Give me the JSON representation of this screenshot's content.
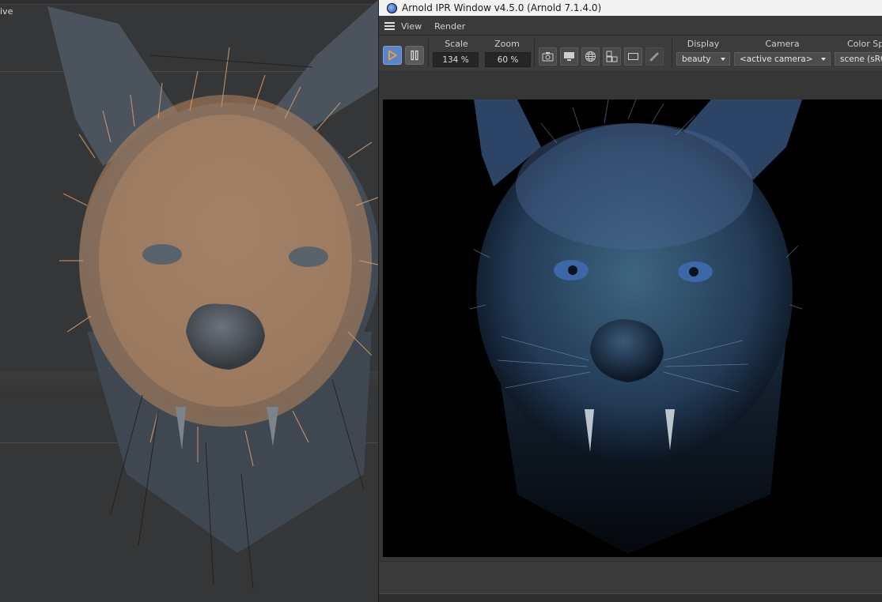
{
  "viewport": {
    "label": "ive"
  },
  "ipr": {
    "title": "Arnold IPR Window v4.5.0 (Arnold 7.1.4.0)",
    "menu": [
      "View",
      "Render"
    ],
    "scale": {
      "label": "Scale",
      "value": "134 %"
    },
    "zoom": {
      "label": "Zoom",
      "value": "60 %"
    },
    "display": {
      "label": "Display",
      "value": "beauty"
    },
    "camera": {
      "label": "Camera",
      "value": "<active camera>"
    },
    "color_space": {
      "label": "Color Spa",
      "value": "scene (sRGB"
    }
  },
  "colors": {
    "accent": "#5c85c9",
    "fur_viewport": "#c8946a",
    "render_tint": "#2f4d6a"
  },
  "icons": [
    "app-icon",
    "hamburger-icon",
    "play-icon",
    "pause-icon",
    "snapshot-icon",
    "display-icon",
    "globe-icon",
    "layout-icon",
    "region-icon",
    "debug-icon"
  ]
}
